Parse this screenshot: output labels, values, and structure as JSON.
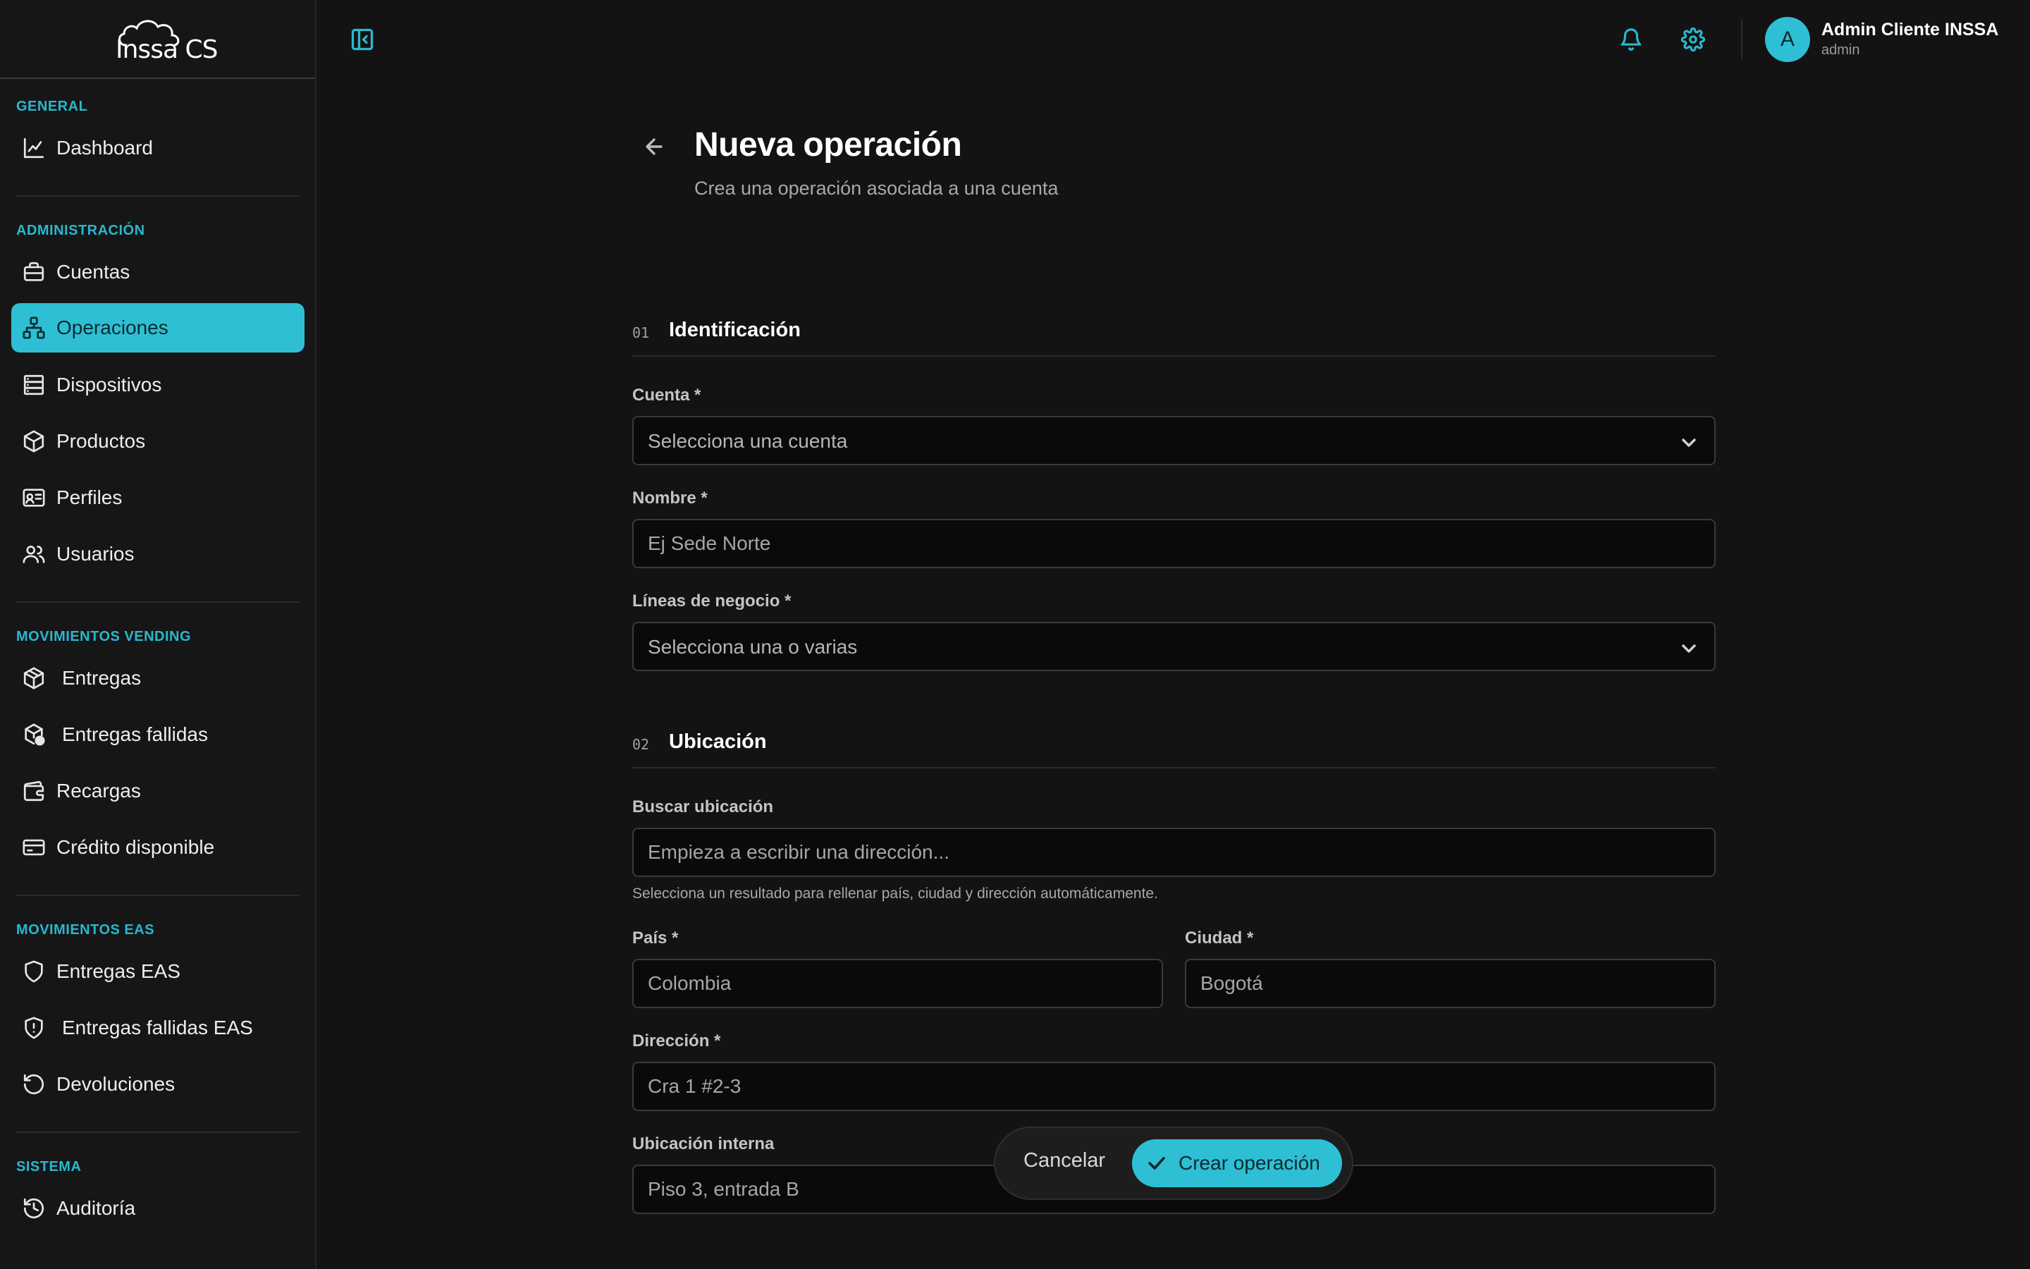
{
  "app": {
    "logo_text": "Inssa CS"
  },
  "sidebar": {
    "sections": [
      {
        "label": "GENERAL",
        "items": [
          {
            "label": "Dashboard",
            "icon": "chart-line-icon"
          }
        ]
      },
      {
        "label": "ADMINISTRACIÓN",
        "items": [
          {
            "label": "Cuentas",
            "icon": "briefcase-icon"
          },
          {
            "label": "Operaciones",
            "icon": "network-icon",
            "active": true
          },
          {
            "label": "Dispositivos",
            "icon": "server-icon"
          },
          {
            "label": "Productos",
            "icon": "box-icon"
          },
          {
            "label": "Perfiles",
            "icon": "id-card-icon"
          },
          {
            "label": "Usuarios",
            "icon": "users-icon"
          }
        ]
      },
      {
        "label": "MOVIMIENTOS VENDING",
        "items": [
          {
            "label": "Entregas",
            "icon": "package-icon"
          },
          {
            "label": "Entregas fallidas",
            "icon": "package-alert-icon"
          },
          {
            "label": "Recargas",
            "icon": "wallet-icon"
          },
          {
            "label": "Crédito disponible",
            "icon": "credit-card-icon"
          }
        ]
      },
      {
        "label": "MOVIMIENTOS EAS",
        "items": [
          {
            "label": "Entregas EAS",
            "icon": "shield-icon"
          },
          {
            "label": "Entregas fallidas EAS",
            "icon": "shield-alert-icon"
          },
          {
            "label": "Devoluciones",
            "icon": "rotate-ccw-icon"
          }
        ]
      },
      {
        "label": "SISTEMA",
        "items": [
          {
            "label": "Auditoría",
            "icon": "history-icon"
          }
        ]
      }
    ]
  },
  "header": {
    "user_initial": "A",
    "user_name": "Admin Cliente INSSA",
    "user_role": "admin"
  },
  "page": {
    "title": "Nueva operación",
    "subtitle": "Crea una operación asociada a una cuenta"
  },
  "form": {
    "section1": {
      "number": "01",
      "title": "Identificación"
    },
    "cuenta": {
      "label": "Cuenta *",
      "placeholder": "Selecciona una cuenta"
    },
    "nombre": {
      "label": "Nombre *",
      "placeholder": "Ej Sede Norte"
    },
    "lineas": {
      "label": "Líneas de negocio *",
      "placeholder": "Selecciona una o varias"
    },
    "section2": {
      "number": "02",
      "title": "Ubicación"
    },
    "buscar": {
      "label": "Buscar ubicación",
      "placeholder": "Empieza a escribir una dirección...",
      "help": "Selecciona un resultado para rellenar país, ciudad y dirección automáticamente."
    },
    "pais": {
      "label": "País *",
      "placeholder": "Colombia"
    },
    "ciudad": {
      "label": "Ciudad *",
      "placeholder": "Bogotá"
    },
    "direccion": {
      "label": "Dirección *",
      "placeholder": "Cra 1 #2-3"
    },
    "ubicacion_interna": {
      "label": "Ubicación interna",
      "placeholder": "Piso 3, entrada B"
    }
  },
  "actions": {
    "cancel": "Cancelar",
    "create": "Crear operación"
  },
  "colors": {
    "accent": "#2ebfd4",
    "background": "#131313",
    "sidebar": "#161616"
  }
}
